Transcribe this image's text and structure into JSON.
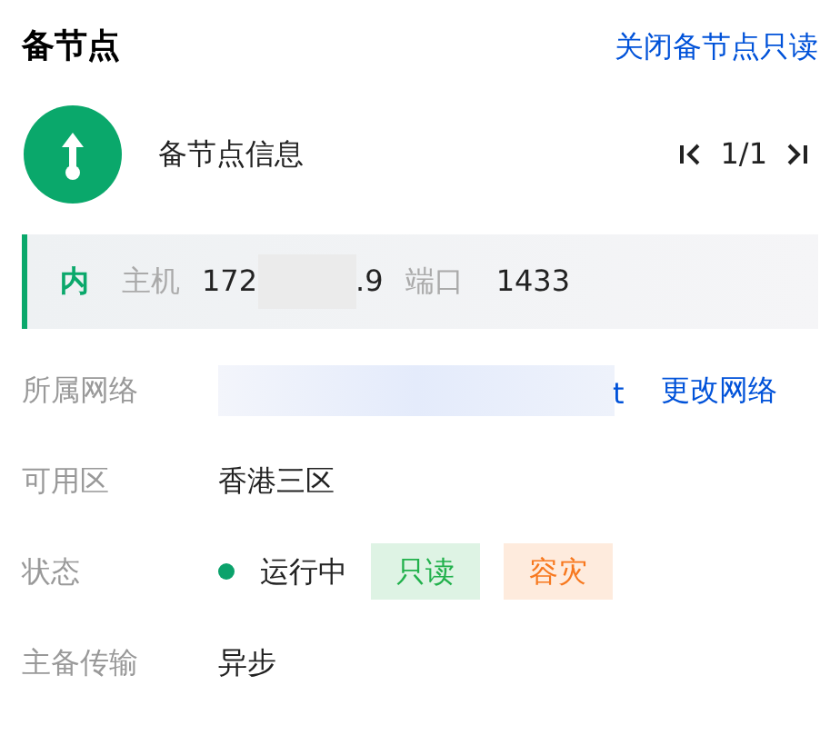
{
  "header": {
    "title": "备节点",
    "action": "关闭备节点只读"
  },
  "node": {
    "label": "备节点信息",
    "pager": "1/1"
  },
  "address": {
    "tag": "内",
    "host_label": "主机",
    "host_start": "172",
    "host_end": ".9",
    "port_label": "端口",
    "port": "1433"
  },
  "fields": [
    {
      "kind": "network",
      "label": "所属网络",
      "value": "t",
      "action": "更改网络"
    },
    {
      "kind": "text",
      "label": "可用区",
      "value": "香港三区"
    },
    {
      "kind": "status",
      "label": "状态",
      "value": "运行中",
      "tags": [
        {
          "text": "只读",
          "color": "#22b14c"
        },
        {
          "text": "容灾",
          "color": "#f7781e"
        }
      ]
    },
    {
      "kind": "text",
      "label": "主备传输",
      "value": "异步"
    }
  ]
}
